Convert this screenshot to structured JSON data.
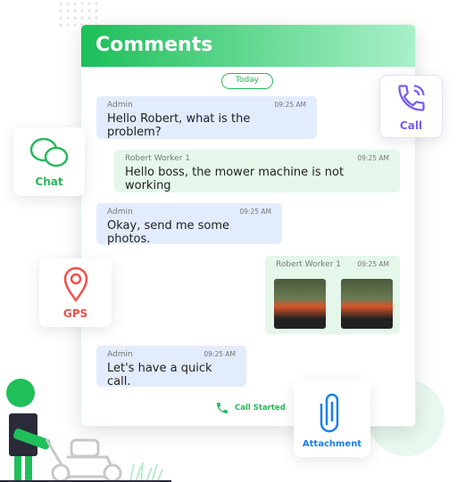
{
  "header": {
    "title": "Comments"
  },
  "date_pill": "Today",
  "messages": [
    {
      "sender": "Admin",
      "time": "09:25 AM",
      "text": "Hello Robert, what is the problem?"
    },
    {
      "sender": "Robert Worker 1",
      "time": "09:25 AM",
      "text": "Hello boss, the mower machine is not working"
    },
    {
      "sender": "Admin",
      "time": "09:25 AM",
      "text": "Okay, send me some photos."
    },
    {
      "sender": "Robert Worker 1",
      "time": "09:25 AM",
      "text": ""
    },
    {
      "sender": "Admin",
      "time": "09:25 AM",
      "text": "Let's have a quick call."
    }
  ],
  "call_status": "Call Started",
  "features": {
    "chat": "Chat",
    "gps": "GPS",
    "call": "Call",
    "attachment": "Attachment"
  },
  "colors": {
    "green": "#1cbf59",
    "blue_bubble": "#e2ecfd",
    "green_bubble": "#e4f7ea",
    "call": "#7a5cf0",
    "gps": "#f0504a",
    "attachment": "#1a7fe8"
  }
}
